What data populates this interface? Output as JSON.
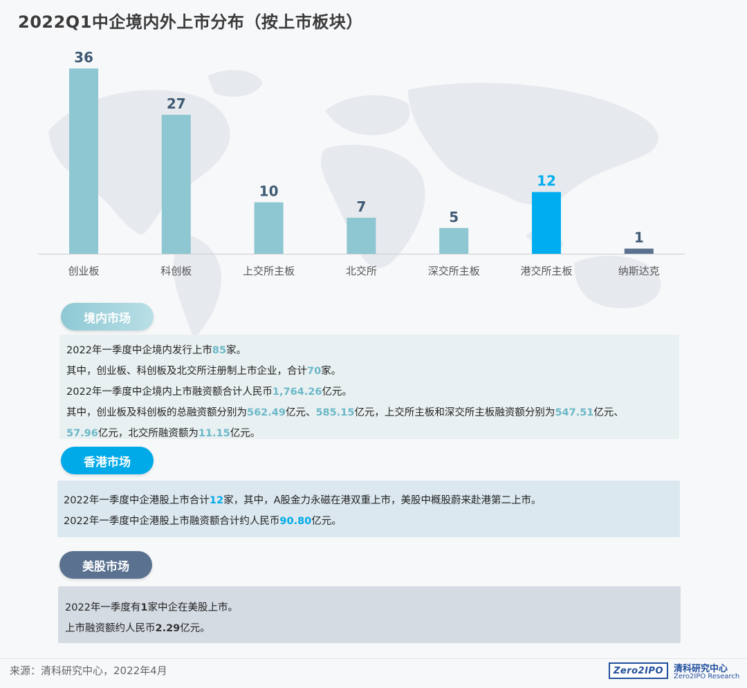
{
  "title": "2022Q1中企境内外上市分布（按上市板块）",
  "chart_data": {
    "type": "bar",
    "categories": [
      "创业板",
      "科创板",
      "上交所主板",
      "北交所",
      "深交所主板",
      "港交所主板",
      "纳斯达克"
    ],
    "values": [
      36,
      27,
      10,
      7,
      5,
      12,
      1
    ],
    "bar_colors": [
      "#8ec6d2",
      "#8ec6d2",
      "#8ec6d2",
      "#8ec6d2",
      "#8ec6d2",
      "#00aeef",
      "#5a7290"
    ],
    "value_colors": [
      "#3f5a74",
      "#3f5a74",
      "#3f5a74",
      "#3f5a74",
      "#3f5a74",
      "#00aeef",
      "#3f5a74"
    ],
    "title": "",
    "xlabel": "",
    "ylabel": "",
    "ylim": [
      0,
      36
    ],
    "grid": false
  },
  "sections": {
    "domestic": {
      "label": "境内市场",
      "lines": [
        [
          {
            "t": "2022年一季度中企境内发行上市"
          },
          {
            "t": "85",
            "hl": "teal"
          },
          {
            "t": "家。"
          }
        ],
        [
          {
            "t": "其中，创业板、科创板及北交所注册制上市企业，合计"
          },
          {
            "t": "70",
            "hl": "teal"
          },
          {
            "t": "家。"
          }
        ],
        [
          {
            "t": "2022年一季度中企境内上市融资额合计人民币"
          },
          {
            "t": "1,764.26",
            "hl": "teal"
          },
          {
            "t": "亿元。"
          }
        ],
        [
          {
            "t": "其中，创业板及科创板的总融资额分别为"
          },
          {
            "t": "562.49",
            "hl": "teal"
          },
          {
            "t": "亿元、"
          },
          {
            "t": "585.15",
            "hl": "teal"
          },
          {
            "t": "亿元，上交所主板和深交所主板融资额分别为"
          },
          {
            "t": "547.51",
            "hl": "teal"
          },
          {
            "t": "亿元、"
          }
        ],
        [
          {
            "t": "57.96",
            "hl": "teal"
          },
          {
            "t": "亿元，北交所融资额为"
          },
          {
            "t": "11.15",
            "hl": "teal"
          },
          {
            "t": "亿元。"
          }
        ]
      ]
    },
    "hk": {
      "label": "香港市场",
      "lines": [
        [
          {
            "t": "2022年一季度中企港股上市合计"
          },
          {
            "t": "12",
            "hl": "blue"
          },
          {
            "t": "家，其中，A股金力永磁在港双重上市，美股中概股蔚来赴港第二上市。"
          }
        ],
        [
          {
            "t": "2022年一季度中企港股上市融资额合计约人民币"
          },
          {
            "t": "90.80",
            "hl": "blue"
          },
          {
            "t": "亿元。"
          }
        ]
      ]
    },
    "us": {
      "label": "美股市场",
      "lines": [
        [
          {
            "t": "2022年一季度有"
          },
          {
            "t": "1",
            "hl": "dark"
          },
          {
            "t": "家中企在美股上市。"
          }
        ],
        [
          {
            "t": "上市融资额约人民币"
          },
          {
            "t": "2.29",
            "hl": "dark"
          },
          {
            "t": "亿元。"
          }
        ]
      ]
    }
  },
  "footer": {
    "source": "来源：清科研究中心，2022年4月",
    "logo_text": "Zero2IPO",
    "brand_cn": "清科研究中心",
    "brand_en": "Zero2IPO Research"
  }
}
